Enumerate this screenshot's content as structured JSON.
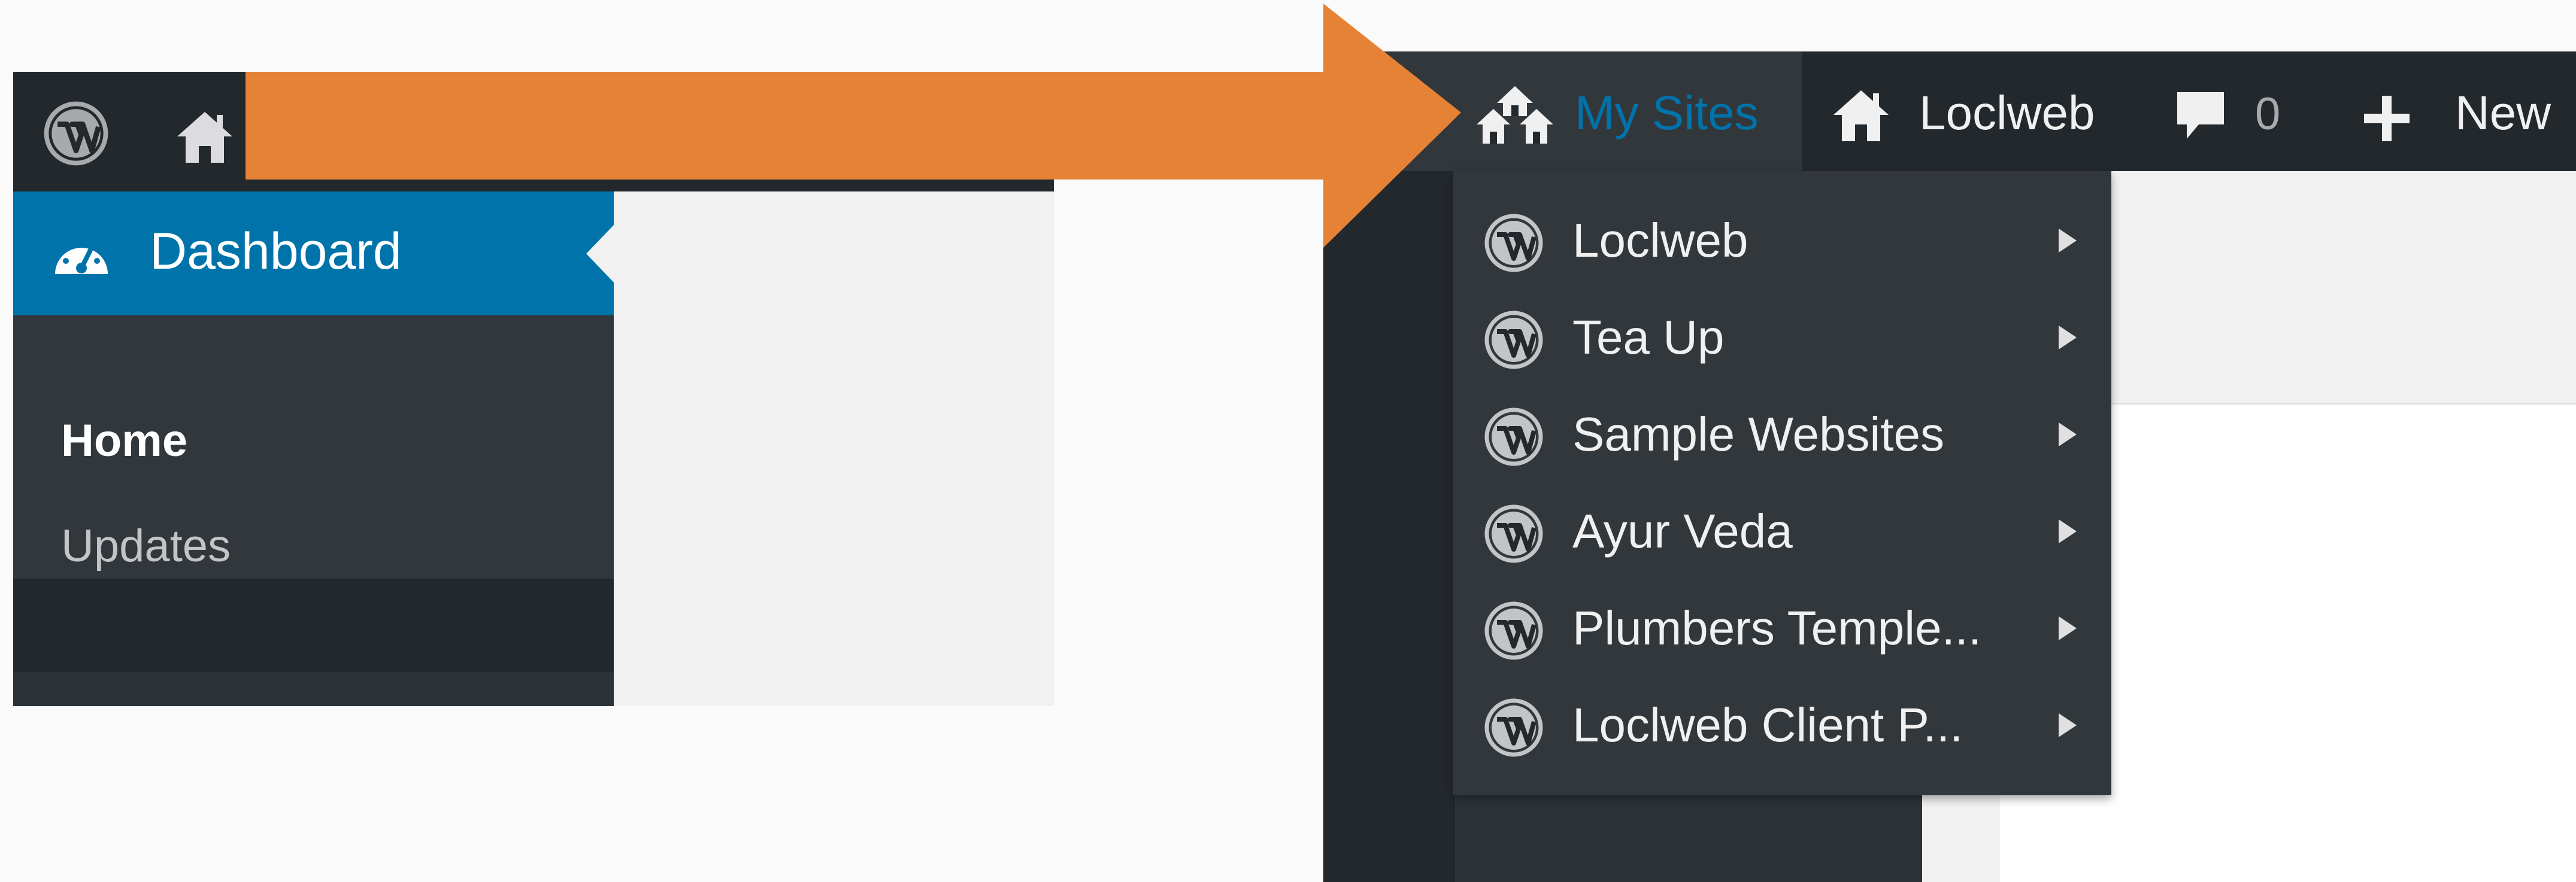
{
  "left": {
    "menu": {
      "dashboard_label": "Dashboard",
      "submenu": [
        "Home",
        "Updates"
      ]
    }
  },
  "right": {
    "adminbar": {
      "my_sites_label": "My Sites",
      "site_label": "Loclweb",
      "comments_count": "0",
      "new_label": "New"
    },
    "my_sites_dropdown": [
      "Loclweb",
      "Tea Up",
      "Sample Websites",
      "Ayur Veda",
      "Plumbers Temple...",
      "Loclweb Client P..."
    ]
  },
  "icons": {
    "left_adminbar": [
      "wordpress-logo-icon",
      "home-icon"
    ],
    "left_menu": [
      "dashboard-gauge-icon"
    ],
    "right_adminbar": [
      "my-sites-icon",
      "home-icon",
      "comment-bubble-icon",
      "plus-icon"
    ],
    "dropdown_item": "wordpress-logo-icon",
    "submenu_indicator": "chevron-right-icon"
  },
  "colors": {
    "admin_bar_bg": "#23282d",
    "menu_active_bg": "#0073aa",
    "submenu_bg": "#32373c",
    "content_bg": "#f1f1f1",
    "my_sites_text": "#0073aa",
    "callout_arrow": "#e68236"
  },
  "annotation": {
    "type": "callout-arrow",
    "direction": "points-right-to-my-sites"
  }
}
